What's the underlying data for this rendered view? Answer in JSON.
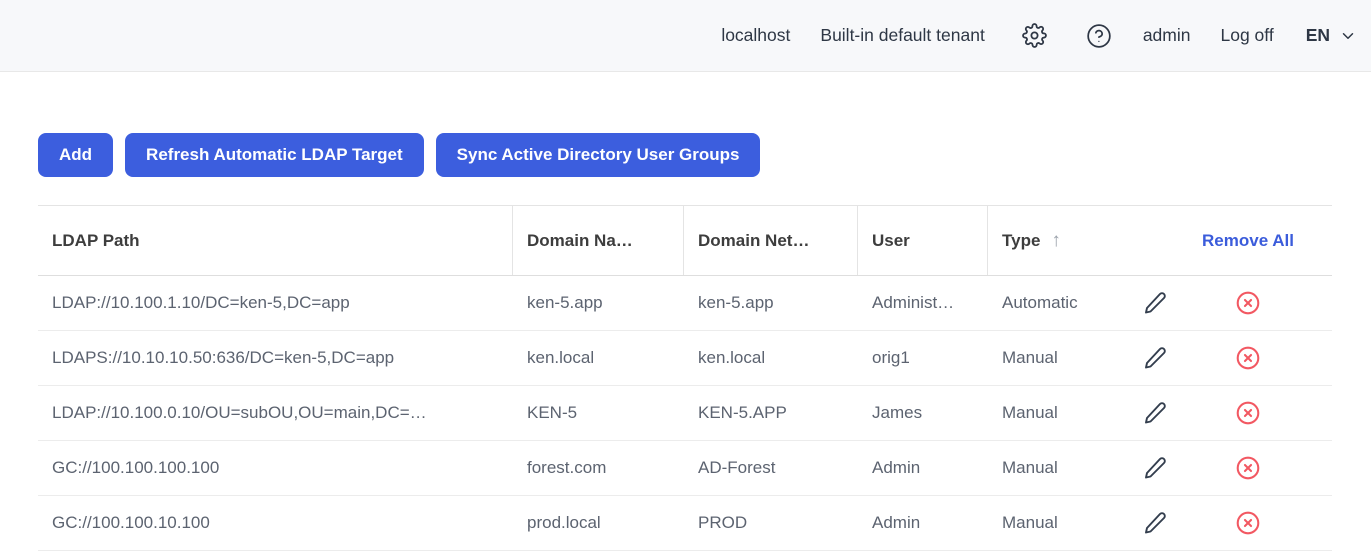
{
  "topbar": {
    "host": "localhost",
    "tenant": "Built-in default tenant",
    "user": "admin",
    "logoff_label": "Log off",
    "language": "EN"
  },
  "toolbar": {
    "add_label": "Add",
    "refresh_label": "Refresh Automatic LDAP Target",
    "sync_label": "Sync Active Directory User Groups"
  },
  "table": {
    "columns": [
      "LDAP Path",
      "Domain Na…",
      "Domain Net…",
      "User",
      "Type"
    ],
    "sort": {
      "column": "Type",
      "direction": "ascending",
      "arrow": "↑"
    },
    "remove_all_label": "Remove All",
    "rows": [
      {
        "ldap_path": "LDAP://10.100.1.10/DC=ken-5,DC=app",
        "domain_name": "ken-5.app",
        "domain_netbios": "ken-5.app",
        "user": "Administ…",
        "type": "Automatic"
      },
      {
        "ldap_path": "LDAPS://10.10.10.50:636/DC=ken-5,DC=app",
        "domain_name": "ken.local",
        "domain_netbios": "ken.local",
        "user": "orig1",
        "type": "Manual"
      },
      {
        "ldap_path": "LDAP://10.100.0.10/OU=subOU,OU=main,DC=…",
        "domain_name": "KEN-5",
        "domain_netbios": "KEN-5.APP",
        "user": "James",
        "type": "Manual"
      },
      {
        "ldap_path": "GC://100.100.100.100",
        "domain_name": "forest.com",
        "domain_netbios": "AD-Forest",
        "user": "Admin",
        "type": "Manual"
      },
      {
        "ldap_path": "GC://100.100.10.100",
        "domain_name": "prod.local",
        "domain_netbios": "PROD",
        "user": "Admin",
        "type": "Manual"
      }
    ]
  },
  "colors": {
    "accent_blue": "#3c5ede",
    "link_blue": "#3b5cdb",
    "danger_red": "#f25862",
    "topbar_bg": "#f7f8fa"
  }
}
